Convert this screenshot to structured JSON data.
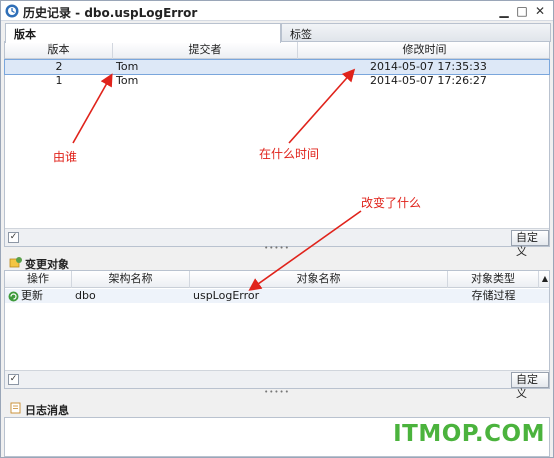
{
  "window": {
    "title": "历史记录 - dbo.uspLogError"
  },
  "tabs": [
    {
      "label": "版本",
      "active": true
    },
    {
      "label": "标签",
      "active": false
    }
  ],
  "versions": {
    "columns": [
      "版本",
      "提交者",
      "修改时间"
    ],
    "rows": [
      {
        "version": "2",
        "author": "Tom",
        "time": "2014-05-07 17:35:33",
        "selected": true
      },
      {
        "version": "1",
        "author": "Tom",
        "time": "2014-05-07 17:26:27",
        "selected": false
      }
    ],
    "customize_label": "自定义"
  },
  "changed_objects": {
    "title": "变更对象",
    "columns": [
      "操作",
      "架构名称",
      "对象名称",
      "对象类型"
    ],
    "rows": [
      {
        "action": "更新",
        "schema": "dbo",
        "name": "uspLogError",
        "type": "存储过程"
      }
    ],
    "customize_label": "自定义"
  },
  "log": {
    "title": "日志消息"
  },
  "annotations": {
    "by_whom": "由谁",
    "when": "在什么时间",
    "what_changed": "改变了什么"
  },
  "watermark": "ITMOP.COM",
  "colors": {
    "annotation": "#e0231b",
    "watermark": "#4bb33d",
    "selection": "#dde8f7"
  }
}
